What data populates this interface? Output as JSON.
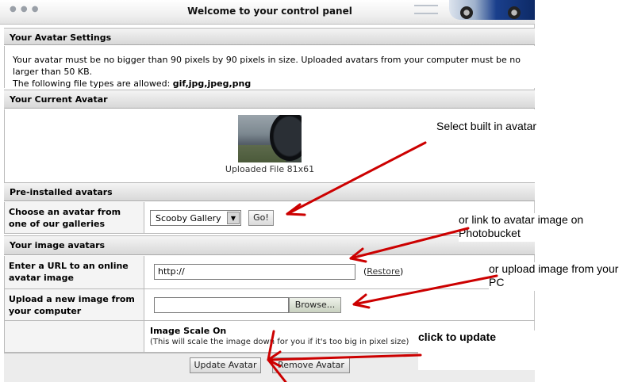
{
  "window": {
    "title": "Welcome to your control panel"
  },
  "avatar_settings": {
    "heading": "Your Avatar Settings",
    "line1": "Your avatar must be no bigger than 90 pixels by 90 pixels in size. Uploaded avatars from your computer must be no larger than 50 KB.",
    "line2_prefix": "The following file types are allowed: ",
    "line2_types": "gif,jpg,jpeg,png"
  },
  "current_avatar": {
    "heading": "Your Current Avatar",
    "caption": "Uploaded File 81x61"
  },
  "preinstalled": {
    "heading": "Pre-installed avatars",
    "label": "Choose an avatar from one of our galleries",
    "selected": "Scooby Gallery",
    "go_label": "Go!"
  },
  "image_avatars": {
    "heading": "Your image avatars",
    "url_label": "Enter a URL to an online avatar image",
    "url_value": "http://",
    "restore_label": "Restore",
    "upload_label": "Upload a new image from your computer",
    "browse_label": "Browse...",
    "scale_title": "Image Scale On",
    "scale_desc": "(This will scale the image down for you if it's too big in pixel size)"
  },
  "actions": {
    "update_label": "Update Avatar",
    "remove_label": "Remove Avatar"
  },
  "annotations": {
    "select_builtin": "Select built in avatar",
    "link_photobucket": "or link to avatar image on Photobucket",
    "upload_pc": "or upload image from your PC",
    "click_update": "click to update"
  },
  "colors": {
    "arrow": "#cc0000"
  }
}
